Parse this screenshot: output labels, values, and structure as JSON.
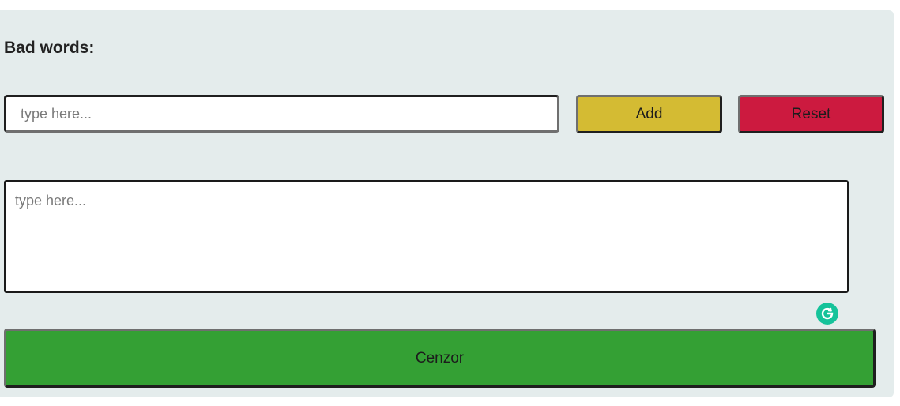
{
  "form": {
    "heading": "Bad words:",
    "word_input": {
      "value": "",
      "placeholder": "type here..."
    },
    "add_label": "Add",
    "reset_label": "Reset",
    "text_input": {
      "value": "",
      "placeholder": "type here..."
    },
    "cenzor_label": "Cenzor"
  },
  "icons": {
    "grammarly": "grammarly-g-icon"
  },
  "colors": {
    "panel_bg": "#e4ecec",
    "add_button": "#d4bb33",
    "reset_button": "#cc1a3f",
    "cenzor_button": "#34a034",
    "grammarly_badge": "#15c39a"
  }
}
